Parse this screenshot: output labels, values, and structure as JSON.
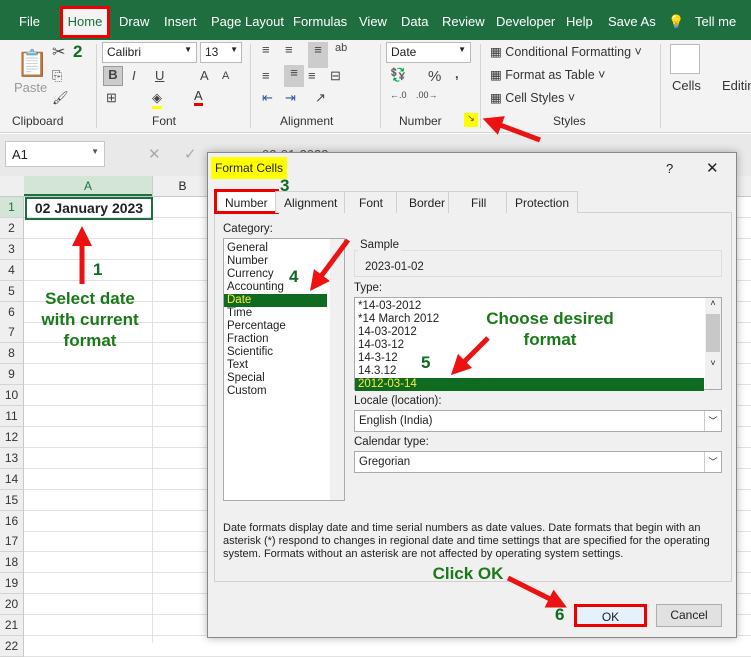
{
  "ribbon_tabs": [
    "File",
    "Home",
    "Draw",
    "Insert",
    "Page Layout",
    "Formulas",
    "View",
    "Data",
    "Review",
    "Developer",
    "Help",
    "Save As",
    "Tell me"
  ],
  "ribbon": {
    "paste": "Paste",
    "font_name": "Calibri",
    "font_size": "13",
    "number_format": "Date",
    "conditional_formatting": "Conditional Formatting",
    "format_as_table": "Format as Table",
    "cell_styles": "Cell Styles",
    "cells": "Cells",
    "editing": "Editing",
    "groups": [
      "Clipboard",
      "Font",
      "Alignment",
      "Number",
      "Styles"
    ]
  },
  "formula_bar": {
    "name_box": "A1",
    "content": "02-01-2023"
  },
  "sheet": {
    "columns": [
      "A",
      "B"
    ],
    "rows": [
      "1",
      "2",
      "3",
      "4",
      "5",
      "6",
      "7",
      "8",
      "9",
      "10",
      "11",
      "12",
      "13",
      "14",
      "15",
      "16",
      "17",
      "18",
      "19",
      "20",
      "21",
      "22"
    ],
    "a1": "02 January 2023"
  },
  "dialog": {
    "title": "Format Cells",
    "help": "?",
    "close": "✕",
    "tabs": [
      "Number",
      "Alignment",
      "Font",
      "Border",
      "Fill",
      "Protection"
    ],
    "category_label": "Category:",
    "categories": [
      "General",
      "Number",
      "Currency",
      "Accounting",
      "Date",
      "Time",
      "Percentage",
      "Fraction",
      "Scientific",
      "Text",
      "Special",
      "Custom"
    ],
    "selected_category": "Date",
    "sample_label": "Sample",
    "sample_value": "2023-01-02",
    "type_label": "Type:",
    "types": [
      "*14-03-2012",
      "*14 March 2012",
      "14-03-2012",
      "14-03-12",
      "14-3-12",
      "14.3.12",
      "2012-03-14"
    ],
    "selected_type": "2012-03-14",
    "locale_label": "Locale (location):",
    "locale": "English (India)",
    "calendar_label": "Calendar type:",
    "calendar": "Gregorian",
    "description": "Date formats display date and time serial numbers as date values.  Date formats that begin with an asterisk (*) respond to changes in regional date and time settings that are specified for the operating system. Formats without an asterisk are not affected by operating system settings.",
    "ok": "OK",
    "cancel": "Cancel"
  },
  "annotations": {
    "n1": "1",
    "n2": "2",
    "n3": "3",
    "n4": "4",
    "n5": "5",
    "n6": "6",
    "select_date": "Select date with current format",
    "choose_format": "Choose desired format",
    "click_ok": "Click OK"
  },
  "colors": {
    "excel_green": "#1f6e3f",
    "highlight": "#ffff00",
    "arrow": "#ee1111"
  }
}
